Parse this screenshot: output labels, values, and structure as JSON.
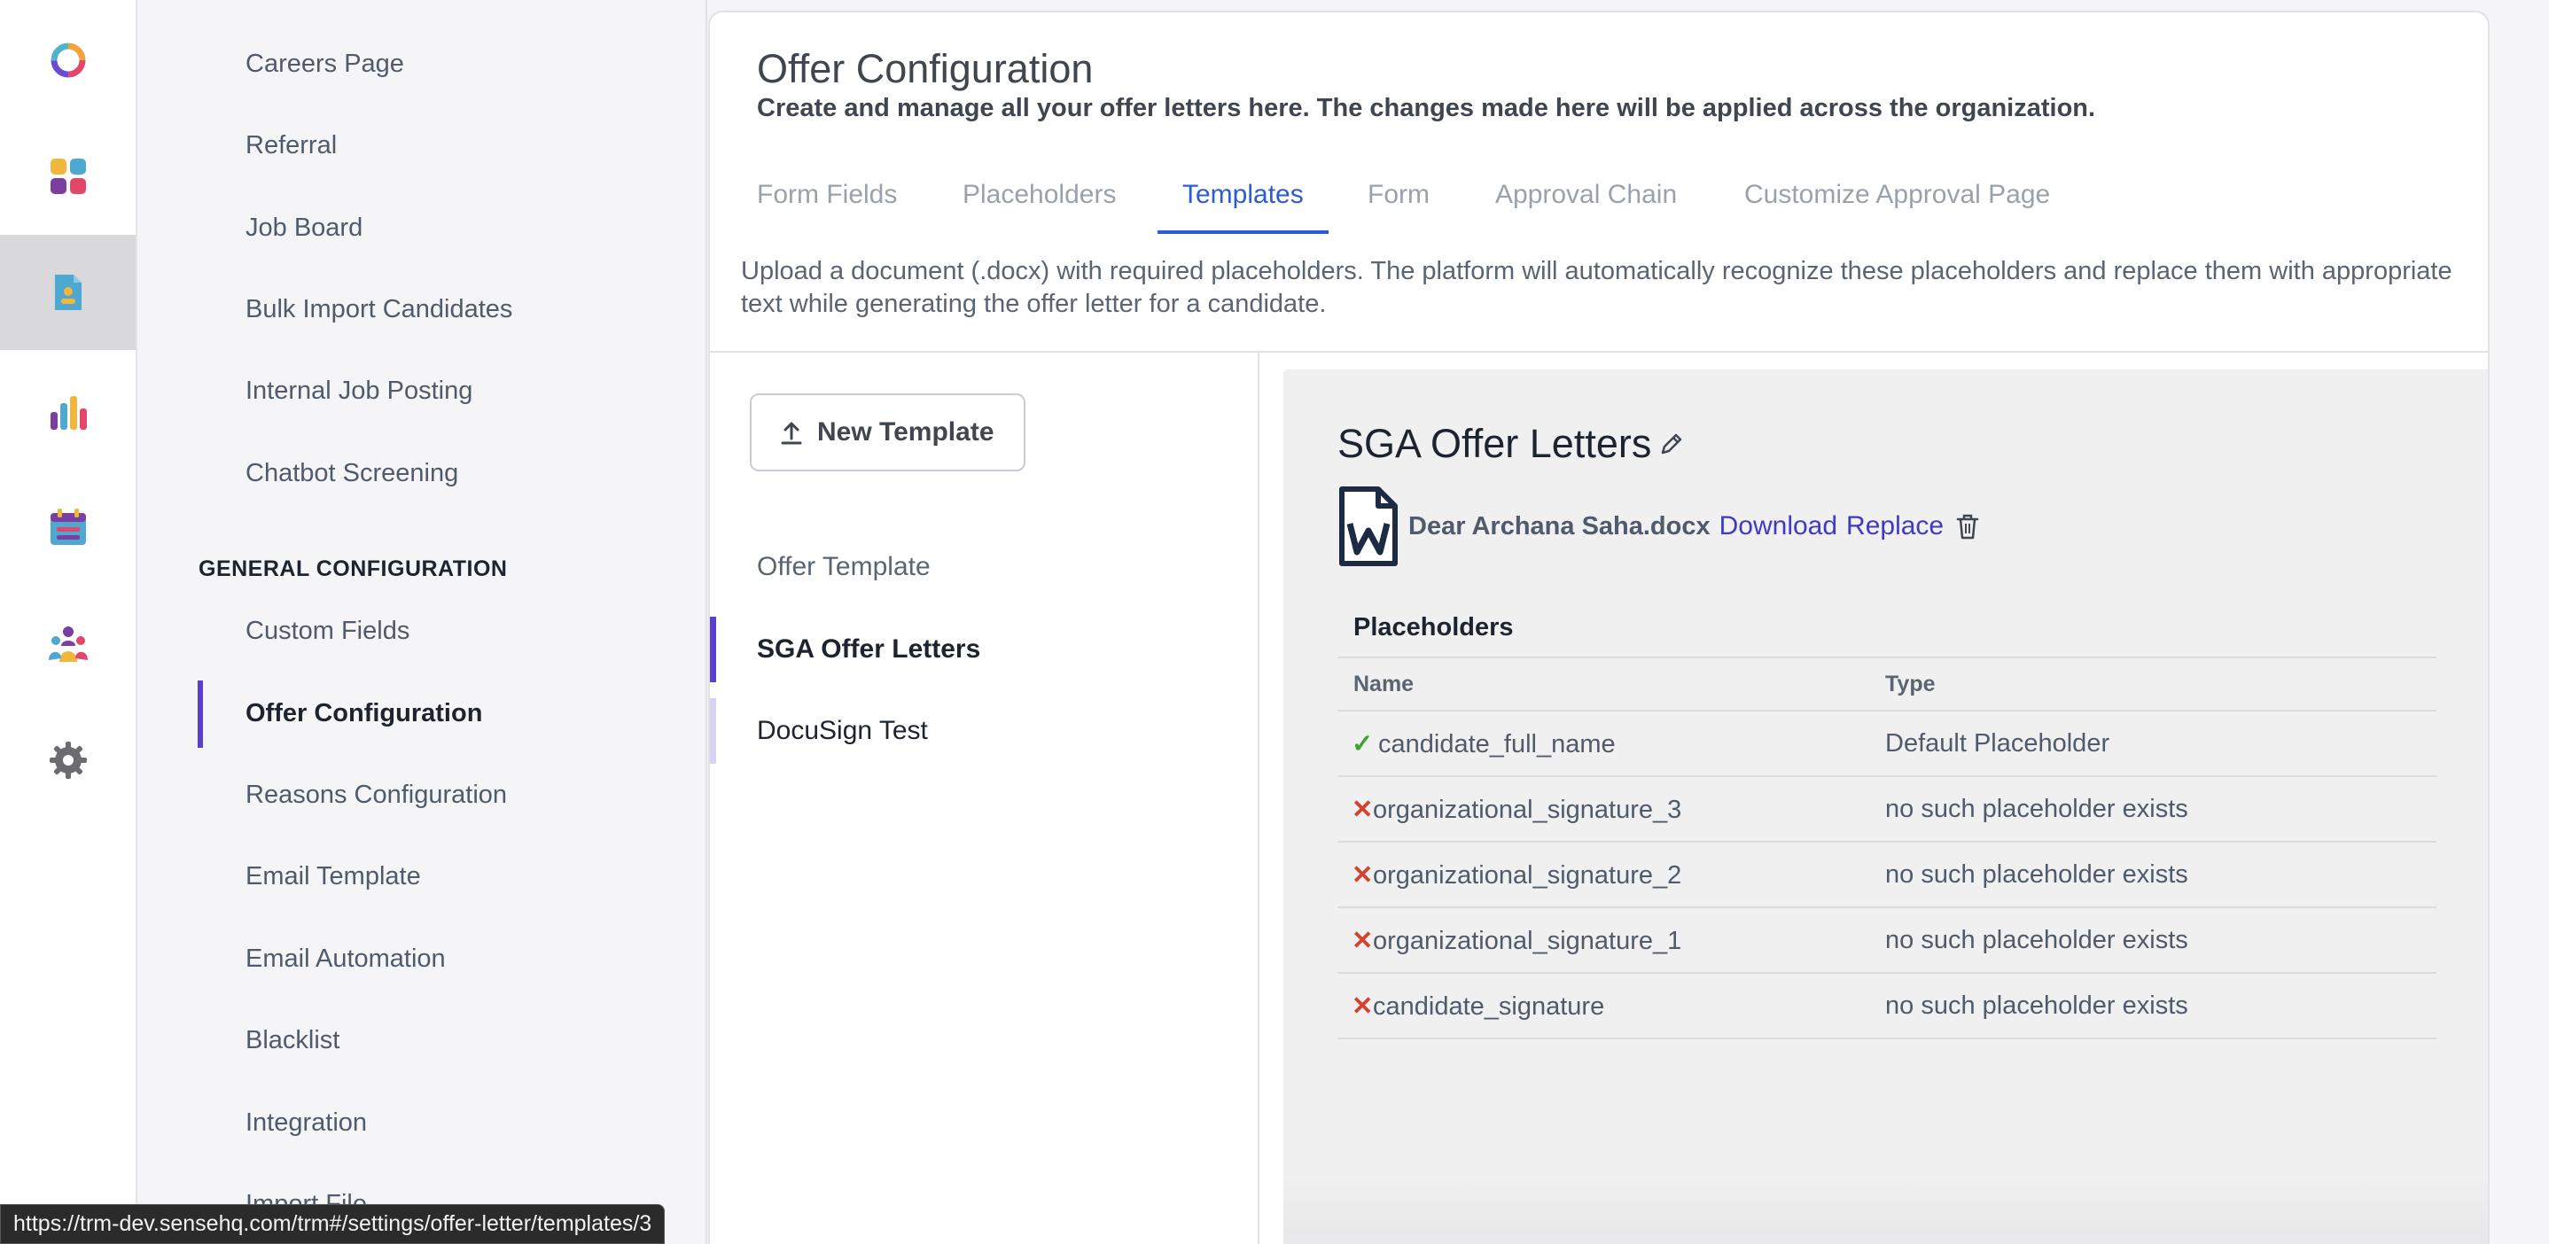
{
  "rail": {
    "items": [
      {
        "icon": "logo-ring-icon"
      },
      {
        "icon": "dashboard-grid-icon"
      },
      {
        "icon": "candidate-document-icon",
        "active": true
      },
      {
        "icon": "analytics-bars-icon"
      },
      {
        "icon": "calendar-icon"
      },
      {
        "icon": "team-people-icon"
      },
      {
        "icon": "gear-icon"
      }
    ]
  },
  "sidebar": {
    "items_top": [
      "Careers Page",
      "Referral",
      "Job Board",
      "Bulk Import Candidates",
      "Internal Job Posting",
      "Chatbot Screening"
    ],
    "section_title": "GENERAL CONFIGURATION",
    "items_general": [
      "Custom Fields",
      "Offer Configuration",
      "Reasons Configuration",
      "Email Template",
      "Email Automation",
      "Blacklist",
      "Integration",
      "Import File"
    ],
    "selected": "Offer Configuration"
  },
  "panel": {
    "title": "Offer Configuration",
    "subtitle": "Create and manage all your offer letters here. The changes made here will be applied across the organization.",
    "tabs": [
      "Form Fields",
      "Placeholders",
      "Templates",
      "Form",
      "Approval Chain",
      "Customize Approval Page"
    ],
    "active_tab": "Templates",
    "description": "Upload a document (.docx) with required placeholders. The platform will automatically recognize these placeholders and replace them with appropriate text while generating the offer letter for a candidate."
  },
  "templates": {
    "new_button": "New Template",
    "list": [
      "Offer Template",
      "SGA Offer Letters",
      "DocuSign Test"
    ],
    "selected": "SGA Offer Letters"
  },
  "detail": {
    "title": "SGA Offer Letters",
    "file_name": "Dear Archana Saha.docx",
    "download_label": "Download",
    "replace_label": "Replace",
    "placeholders_title": "Placeholders",
    "columns": [
      "Name",
      "Type"
    ],
    "rows": [
      {
        "status": "valid",
        "name": "candidate_full_name",
        "type": "Default Placeholder"
      },
      {
        "status": "invalid",
        "name": "organizational_signature_3",
        "type": "no such placeholder exists"
      },
      {
        "status": "invalid",
        "name": "organizational_signature_2",
        "type": "no such placeholder exists"
      },
      {
        "status": "invalid",
        "name": "organizational_signature_1",
        "type": "no such placeholder exists"
      },
      {
        "status": "invalid",
        "name": "candidate_signature",
        "type": "no such placeholder exists"
      }
    ],
    "status_marks": {
      "valid": "✓",
      "invalid": "✕"
    }
  },
  "status_bar": {
    "url": "https://trm-dev.sensehq.com/trm#/settings/offer-letter/templates/3"
  },
  "colors": {
    "accent": "#5b3fd0",
    "tab_active": "#2b5bd6",
    "link": "#3f3ac4",
    "valid": "#3ea52f",
    "invalid": "#d3412f"
  }
}
